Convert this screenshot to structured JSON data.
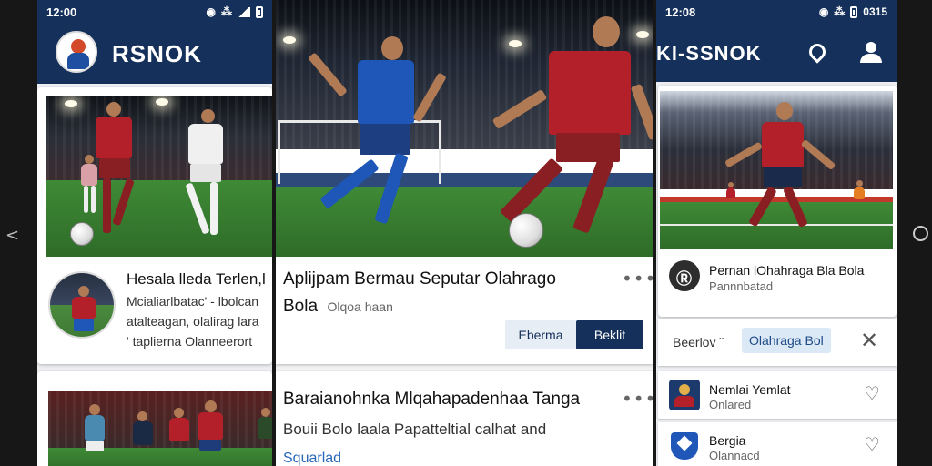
{
  "screen_left": {
    "status_time": "12:00",
    "app_title": "RSNOK",
    "card1": {
      "title": "Hesala lleda Terlen,l",
      "line1": "Mcialiarlbatac' - lbolcan",
      "line2": "atalteagan, olalirag lara",
      "line3": "' taplierna Olanneerort"
    }
  },
  "screen_center": {
    "card1": {
      "title": "Aplijpam Bermau Seputar Olahrago",
      "subtitle": "Bola",
      "subtitle_muted": "Olqoa haan",
      "more": "•••",
      "button_light": "Eberma",
      "button_dark": "Beklit"
    },
    "card2": {
      "title": "Baraianohnka Mlqahapadenhaa Tanga",
      "line1": "Bouii Bolo laala Papatteltial calhat and",
      "link": "Squarlad",
      "more": "•••"
    }
  },
  "screen_right": {
    "status_time": "12:08",
    "status_battery": "0315",
    "app_title": "KI-SSNOK",
    "card1": {
      "title": "Pernan lOhahraga Bla Bola",
      "subtitle": "Pannnbatad"
    },
    "filter": {
      "chip1": "Beerlov ˇ",
      "chip2": "Olahraga Bol",
      "close": "✕"
    },
    "list": [
      {
        "title": "Nemlai Yemlat",
        "subtitle": "Onlared"
      },
      {
        "title": "Bergia",
        "subtitle": "Olannacd"
      }
    ]
  },
  "colors": {
    "brand_navy": "#15305a",
    "kit_red": "#b3202a",
    "kit_blue": "#1f57b8",
    "pitch_green": "#3f8a36"
  }
}
